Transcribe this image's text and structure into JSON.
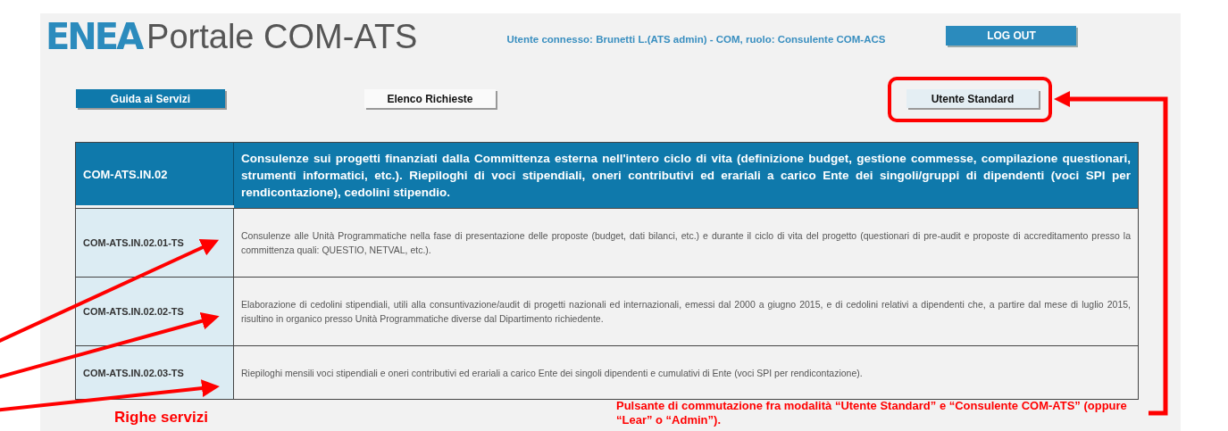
{
  "header": {
    "logo": "ENEA",
    "title": "Portale COM-ATS",
    "user_info": "Utente connesso: Brunetti L.(ATS admin) - COM, ruolo: Consulente COM-ACS",
    "logout_button": "LOG OUT"
  },
  "nav_buttons": [
    {
      "label": "Guida ai Servizi",
      "selected": true
    },
    {
      "label": "Elenco Richieste",
      "selected": false
    },
    {
      "label": "Utente Standard",
      "selected": false
    }
  ],
  "table": {
    "header": {
      "code": "COM-ATS.IN.02",
      "description": "Consulenze sui progetti finanziati dalla Committenza esterna nell'intero ciclo di vita (definizione budget, gestione commesse, compilazione questionari, strumenti informatici, etc.). Riepiloghi di voci stipendiali, oneri contributivi ed erariali a carico Ente dei singoli/gruppi di dipendenti (voci SPI per rendicontazione), cedolini stipendio."
    },
    "rows": [
      {
        "code": "COM-ATS.IN.02.01-TS",
        "description": "Consulenze alle Unità Programmatiche nella fase di presentazione delle proposte (budget, dati bilanci, etc.) e durante il ciclo di vita del progetto (questionari di pre-audit e proposte di accreditamento presso la committenza quali: QUESTIO, NETVAL, etc.)."
      },
      {
        "code": "COM-ATS.IN.02.02-TS",
        "description": "Elaborazione di cedolini stipendiali, utili alla consuntivazione/audit di progetti nazionali ed internazionali, emessi dal 2000 a giugno 2015, e di cedolini relativi a dipendenti che, a partire dal mese di luglio 2015, risultino in organico presso Unità Programmatiche diverse dal Dipartimento richiedente."
      },
      {
        "code": "COM-ATS.IN.02.03-TS",
        "description": "Riepiloghi mensili voci stipendiali e oneri contributivi ed erariali a carico Ente dei singoli dipendenti e cumulativi di Ente (voci SPI per rendicontazione)."
      }
    ]
  },
  "annotations": {
    "button_note": "Pulsante di commutazione fra modalità “Utente Standard” e “Consulente COM-ATS” (oppure “Lear” o “Admin”).",
    "rows_note": "Righe servizi"
  }
}
